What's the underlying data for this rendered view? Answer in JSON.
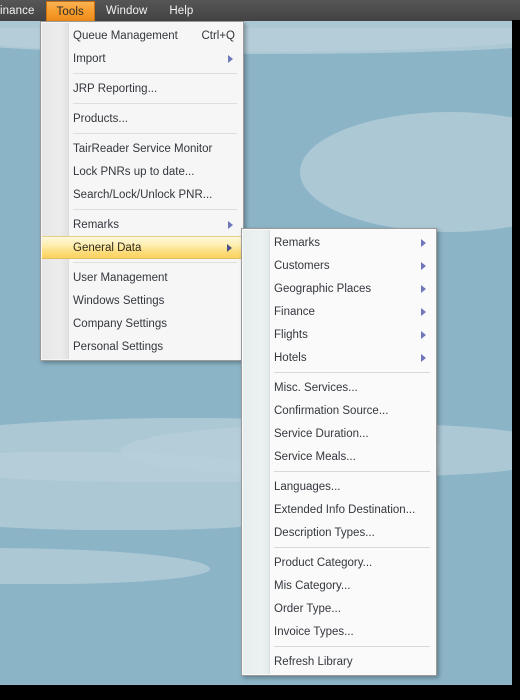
{
  "menubar": {
    "items": [
      {
        "label": "inance",
        "state": "clipped",
        "icon": ""
      },
      {
        "label": "Tools",
        "state": "active",
        "icon": ""
      },
      {
        "label": "Window",
        "state": "normal",
        "icon": ""
      },
      {
        "label": "Help",
        "state": "normal",
        "icon": ""
      }
    ]
  },
  "colors": {
    "menubar_bg": "#4c4c4c",
    "active_menu_accent": "#f79f30",
    "highlight_top": "#fdf7db",
    "highlight_bottom": "#fbd25f",
    "submenu_arrow": "#6e77bb",
    "desktop_bg": "#8bb4c7",
    "desktop_wave": "#b7cfd9"
  },
  "tools_menu": {
    "title": "Tools",
    "items": [
      {
        "label": "Queue Management",
        "accel": "Ctrl+Q",
        "arrow": false,
        "selected": false,
        "sep_after": false
      },
      {
        "label": "Import",
        "accel": "",
        "arrow": true,
        "selected": false,
        "sep_after": true
      },
      {
        "label": "JRP Reporting...",
        "accel": "",
        "arrow": false,
        "selected": false,
        "sep_after": true
      },
      {
        "label": "Products...",
        "accel": "",
        "arrow": false,
        "selected": false,
        "sep_after": true
      },
      {
        "label": "TairReader Service Monitor",
        "accel": "",
        "arrow": false,
        "selected": false,
        "sep_after": false
      },
      {
        "label": "Lock PNRs up to date...",
        "accel": "",
        "arrow": false,
        "selected": false,
        "sep_after": false
      },
      {
        "label": "Search/Lock/Unlock PNR...",
        "accel": "",
        "arrow": false,
        "selected": false,
        "sep_after": true
      },
      {
        "label": "Remarks",
        "accel": "",
        "arrow": true,
        "selected": false,
        "sep_after": false
      },
      {
        "label": "General Data",
        "accel": "",
        "arrow": true,
        "selected": true,
        "sep_after": true
      },
      {
        "label": "User Management",
        "accel": "",
        "arrow": false,
        "selected": false,
        "sep_after": false
      },
      {
        "label": "Windows Settings",
        "accel": "",
        "arrow": false,
        "selected": false,
        "sep_after": false
      },
      {
        "label": "Company Settings",
        "accel": "",
        "arrow": false,
        "selected": false,
        "sep_after": false
      },
      {
        "label": "Personal Settings",
        "accel": "",
        "arrow": false,
        "selected": false,
        "sep_after": false
      }
    ]
  },
  "general_data_submenu": {
    "title": "General Data",
    "items": [
      {
        "label": "Remarks",
        "arrow": true,
        "selected": false,
        "sep_after": false
      },
      {
        "label": "Customers",
        "arrow": true,
        "selected": false,
        "sep_after": false
      },
      {
        "label": "Geographic Places",
        "arrow": true,
        "selected": false,
        "sep_after": false
      },
      {
        "label": "Finance",
        "arrow": true,
        "selected": false,
        "sep_after": false
      },
      {
        "label": "Flights",
        "arrow": true,
        "selected": false,
        "sep_after": false
      },
      {
        "label": "Hotels",
        "arrow": true,
        "selected": false,
        "sep_after": true
      },
      {
        "label": "Misc. Services...",
        "arrow": false,
        "selected": false,
        "sep_after": false
      },
      {
        "label": "Confirmation Source...",
        "arrow": false,
        "selected": false,
        "sep_after": false
      },
      {
        "label": "Service Duration...",
        "arrow": false,
        "selected": false,
        "sep_after": false
      },
      {
        "label": "Service Meals...",
        "arrow": false,
        "selected": false,
        "sep_after": true
      },
      {
        "label": "Languages...",
        "arrow": false,
        "selected": false,
        "sep_after": false
      },
      {
        "label": "Extended Info Destination...",
        "arrow": false,
        "selected": false,
        "sep_after": false
      },
      {
        "label": "Description Types...",
        "arrow": false,
        "selected": false,
        "sep_after": true
      },
      {
        "label": "Product Category...",
        "arrow": false,
        "selected": false,
        "sep_after": false
      },
      {
        "label": "Mis Category...",
        "arrow": false,
        "selected": false,
        "sep_after": false
      },
      {
        "label": "Order Type...",
        "arrow": false,
        "selected": false,
        "sep_after": false
      },
      {
        "label": "Invoice Types...",
        "arrow": false,
        "selected": false,
        "sep_after": true
      },
      {
        "label": "Refresh Library",
        "arrow": false,
        "selected": false,
        "sep_after": false
      }
    ]
  }
}
